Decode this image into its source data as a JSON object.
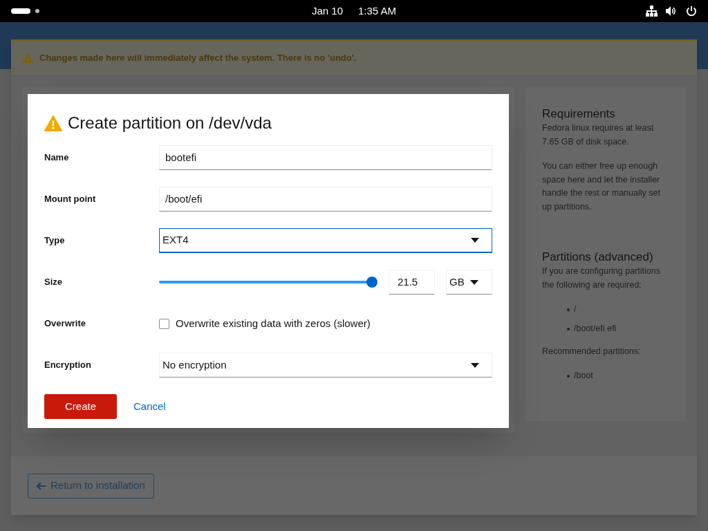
{
  "top_bar": {
    "date": "Jan 10",
    "time": "1:35 AM"
  },
  "banner": {
    "text": "Changes made here will immediately affect the system. There is no 'undo'."
  },
  "sidebar": {
    "sections": [
      {
        "title": "Requirements",
        "paragraphs": [
          "Fedora linux requires at least 7.65 GB of disk space.",
          "You can either free up enough space here and let the installer handle the rest or manually set up partitions."
        ]
      },
      {
        "title": "Partitions (advanced)",
        "paragraphs": [
          "If you are configuring partitions the following are required:"
        ],
        "items": [
          "/",
          "/boot/efi efi"
        ],
        "note": "Recommended partitions:",
        "note_items": [
          "/boot"
        ]
      }
    ]
  },
  "footer": {
    "button": "Return to installation"
  },
  "dialog": {
    "title": "Create partition on /dev/vda",
    "fields": [
      {
        "kind": "text",
        "label": "Name",
        "value": "bootefi",
        "focused": false
      },
      {
        "kind": "text",
        "label": "Mount point",
        "value": "/boot/efi",
        "focused": false
      },
      {
        "kind": "select",
        "label": "Type",
        "value": "EXT4",
        "focused": true
      },
      {
        "kind": "size",
        "label": "Size",
        "level": 1.0,
        "value": "21.5",
        "unit": "GB"
      },
      {
        "kind": "checkbox",
        "label": "Overwrite",
        "text": "Overwrite existing data with zeros (slower)",
        "checked": false
      },
      {
        "kind": "select",
        "label": "Encryption",
        "value": "No encryption",
        "focused": false
      }
    ],
    "buttons": [
      {
        "kind": "primary",
        "label": "Create"
      },
      {
        "kind": "link",
        "label": "Cancel"
      }
    ]
  }
}
